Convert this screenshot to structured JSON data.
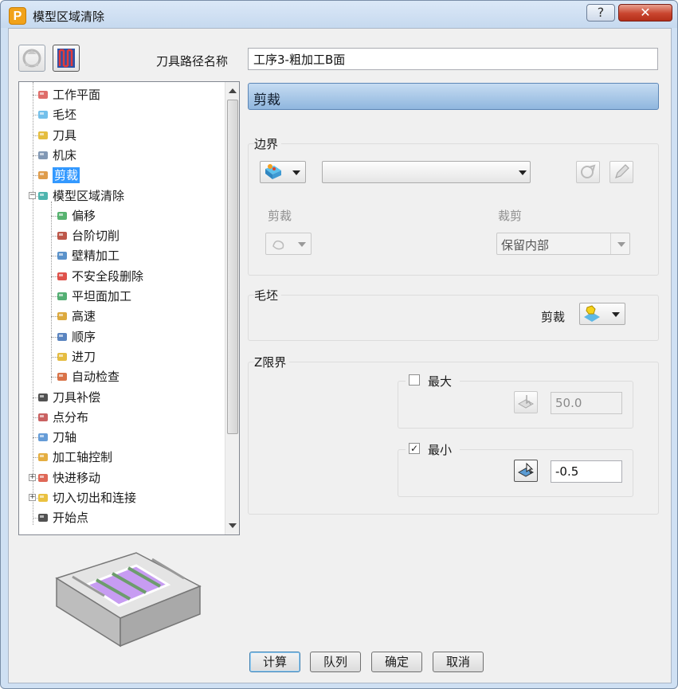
{
  "window": {
    "title": "模型区域清除",
    "help_glyph": "?",
    "close_glyph": "✕"
  },
  "header": {
    "toolpath_name_label": "刀具路径名称",
    "toolpath_name_value": "工序3-粗加工B面"
  },
  "tree": {
    "items": [
      {
        "label": "工作平面",
        "icon": "workplane-icon"
      },
      {
        "label": "毛坯",
        "icon": "block-icon"
      },
      {
        "label": "刀具",
        "icon": "tool-icon"
      },
      {
        "label": "机床",
        "icon": "machine-icon"
      },
      {
        "label": "剪裁",
        "icon": "limit-icon",
        "selected": true
      },
      {
        "label": "模型区域清除",
        "icon": "area-clear-icon",
        "expanded": true
      },
      {
        "label": "偏移",
        "icon": "offset-icon"
      },
      {
        "label": "台阶切削",
        "icon": "step-cutting-icon"
      },
      {
        "label": "壁精加工",
        "icon": "wall-finishing-icon"
      },
      {
        "label": "不安全段删除",
        "icon": "unsafe-segment-icon"
      },
      {
        "label": "平坦面加工",
        "icon": "flat-machining-icon"
      },
      {
        "label": "高速",
        "icon": "high-speed-icon"
      },
      {
        "label": "顺序",
        "icon": "order-icon"
      },
      {
        "label": "进刀",
        "icon": "approach-icon"
      },
      {
        "label": "自动检查",
        "icon": "auto-verify-icon"
      },
      {
        "label": "刀具补偿",
        "icon": "tool-comp-icon"
      },
      {
        "label": "点分布",
        "icon": "point-distribution-icon"
      },
      {
        "label": "刀轴",
        "icon": "tool-axis-icon"
      },
      {
        "label": "加工轴控制",
        "icon": "axis-control-icon"
      },
      {
        "label": "快进移动",
        "icon": "rapid-move-icon",
        "collapsed": true
      },
      {
        "label": "切入切出和连接",
        "icon": "leads-links-icon",
        "collapsed": true
      },
      {
        "label": "开始点",
        "icon": "start-point-icon"
      }
    ]
  },
  "panel": {
    "section_title": "剪裁",
    "boundary": {
      "group_label": "边界",
      "boundary_select_value": "",
      "limit_label": "剪裁",
      "trim_label": "裁剪",
      "trim_value": "保留内部"
    },
    "block": {
      "group_label": "毛坯",
      "limit_label": "剪裁"
    },
    "z_limits": {
      "group_label": "Z限界",
      "max_label": "最大",
      "max_checked": false,
      "max_value": "50.0",
      "min_label": "最小",
      "min_checked": true,
      "min_value": "-0.5",
      "check_glyph": "✓"
    }
  },
  "buttons": {
    "calculate": "计算",
    "queue": "队列",
    "ok": "确定",
    "cancel": "取消"
  }
}
